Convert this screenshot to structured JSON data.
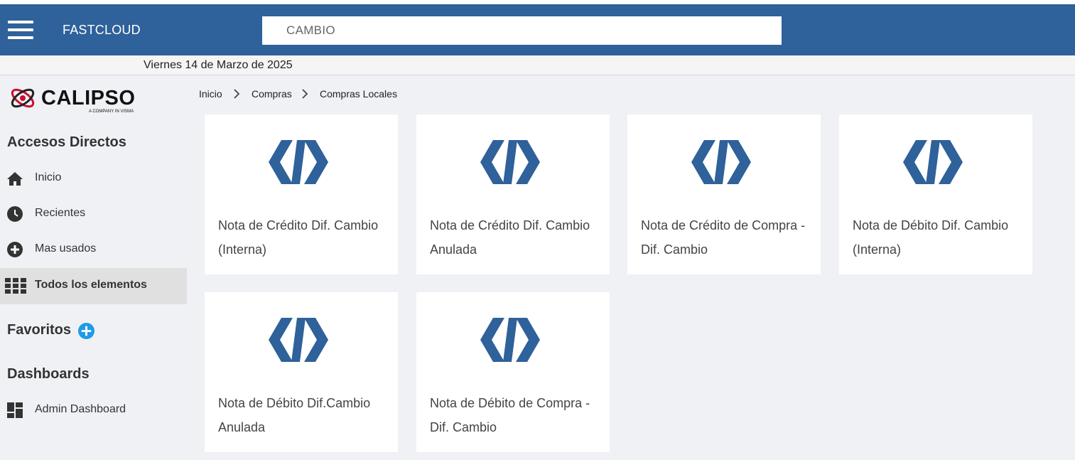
{
  "header": {
    "app_title": "FASTCLOUD",
    "search_value": "CAMBIO",
    "bg_color": "#2f619a"
  },
  "date_bar": {
    "date": "Viernes 14 de Marzo de 2025"
  },
  "logo": {
    "name": "CALIPSO",
    "tagline": "A COMPANY IN VISMA"
  },
  "sidebar": {
    "accesos_title": "Accesos Directos",
    "items": [
      {
        "label": "Inicio",
        "icon": "home-icon"
      },
      {
        "label": "Recientes",
        "icon": "clock-icon"
      },
      {
        "label": "Mas usados",
        "icon": "plus-circle-icon"
      },
      {
        "label": "Todos los elementos",
        "icon": "grid-icon",
        "active": true
      }
    ],
    "favoritos_title": "Favoritos",
    "dashboards_title": "Dashboards",
    "dashboard_items": [
      {
        "label": "Admin Dashboard",
        "icon": "dashboard-icon"
      }
    ]
  },
  "breadcrumb": [
    "Inicio",
    "Compras",
    "Compras Locales"
  ],
  "cards": [
    {
      "label": "Nota de Crédito Dif. Cambio (Interna)"
    },
    {
      "label": "Nota de Crédito Dif. Cambio Anulada"
    },
    {
      "label": "Nota de Crédito de Compra - Dif. Cambio"
    },
    {
      "label": "Nota de Débito Dif. Cambio (Interna)"
    },
    {
      "label": "Nota de Débito Dif.Cambio Anulada"
    },
    {
      "label": "Nota de Débito de Compra - Dif. Cambio"
    }
  ],
  "colors": {
    "accent": "#2f619a",
    "fav_button": "#1e9be8"
  }
}
